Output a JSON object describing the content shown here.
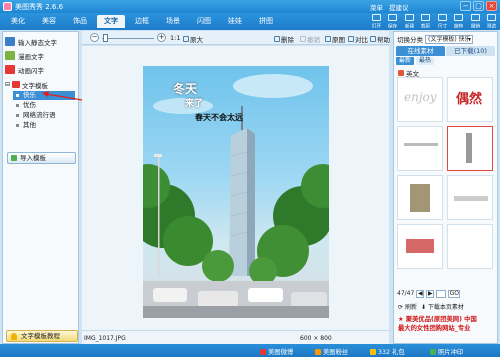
{
  "app": {
    "title": "美图秀秀 2.6.6"
  },
  "top_links": [
    "菜单",
    "提建议"
  ],
  "window_buttons": [
    "−",
    "□",
    "×"
  ],
  "tabs": [
    "美化",
    "美容",
    "饰品",
    "文字",
    "边框",
    "场景",
    "闪图",
    "娃娃",
    "拼图"
  ],
  "toolbar": {
    "tools": [
      "打开",
      "保存",
      "新建",
      "裁剪",
      "尺寸",
      "旋转",
      "撤销",
      "预览"
    ]
  },
  "left_panel": {
    "items": [
      {
        "label": "输入静态文字",
        "color": "#3a7fc8"
      },
      {
        "label": "漫画文字",
        "color": "#7cb342"
      },
      {
        "label": "动画闪字",
        "color": "#e53935"
      }
    ],
    "template_section": "文字模板",
    "template_items": [
      "快乐",
      "忧伤",
      "网络流行语",
      "其他"
    ],
    "selected_template": "快乐",
    "import_button": "导入模板",
    "tutorial_button": "文字模板教程"
  },
  "canvas_toolbar": {
    "zoom_minus": "−",
    "zoom_plus": "+",
    "zoom_label": "1:1",
    "zoom_fit": "原大",
    "buttons": [
      {
        "label": "删除",
        "dim": false
      },
      {
        "label": "撤销",
        "dim": true
      },
      {
        "label": "原图",
        "dim": false
      },
      {
        "label": "对比",
        "dim": false
      },
      {
        "label": "帮助",
        "dim": false
      }
    ]
  },
  "photo": {
    "overlay_line1": "冬天",
    "overlay_line2": "来了",
    "overlay_line3": "春天不会太远"
  },
  "status": {
    "filename": "IMG_1017.JPG",
    "dimensions": "600 × 800"
  },
  "right_panel": {
    "category_label": "切换分类",
    "category_value": "(文字模板) 快乐",
    "tabs": [
      "在线素材",
      "已下载(10)"
    ],
    "subtabs": [
      "最新",
      "最热"
    ],
    "section_title": "英文",
    "thumbnails": [
      "enjoy",
      "偶然",
      "",
      "",
      "",
      "",
      "",
      ""
    ],
    "pager": {
      "current": "47/47",
      "go_label": "GO",
      "prev": "◀",
      "next": "▶"
    },
    "refresh_label": "刷新",
    "download_label": "下载本页素材",
    "ad_line1": "★ 聚美优品(原团美网) 中国",
    "ad_line2": "最大的女性团购网站_专业"
  },
  "bottom_bar": {
    "items": [
      "美图微博",
      "美图粉丝",
      "332 礼包",
      "照片冲印"
    ]
  },
  "colors": {
    "accent": "#1f86d2",
    "selected": "#3b8fd4",
    "ad_red": "#d01818"
  }
}
